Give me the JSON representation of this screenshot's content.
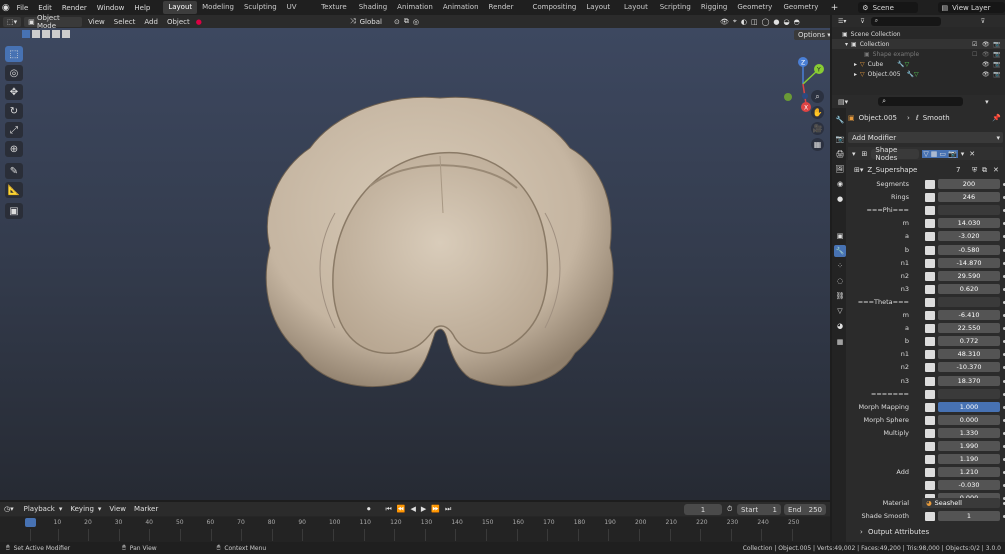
{
  "menus": [
    "File",
    "Edit",
    "Render",
    "Window",
    "Help"
  ],
  "workspaces": [
    "Layout",
    "Modeling",
    "Sculpting",
    "UV Editing",
    "Texture Paint",
    "Shading",
    "Animation",
    "Animation 2",
    "Render Lighting",
    "Compositing",
    "Layout Asset",
    "Layout Shot",
    "Scripting",
    "Rigging",
    "Geometry Nodes",
    "Geometry Nodes 2"
  ],
  "scene": "Scene",
  "view_layer": "View Layer",
  "viewport_header": {
    "mode": "Object Mode",
    "menus": [
      "View",
      "Select",
      "Add",
      "Object"
    ],
    "transform": "Global",
    "options": "Options"
  },
  "outliner": {
    "root": "Scene Collection",
    "collection": "Collection",
    "items": [
      "Shape example",
      "Cube",
      "Object.005"
    ]
  },
  "props": {
    "object": "Object.005",
    "modifier": "Smooth",
    "add_modifier": "Add Modifier",
    "node_group": "Shape Nodes",
    "group_name": "Z_Supershape",
    "group_users": "7",
    "rows": [
      {
        "label": "Segments",
        "value": "200"
      },
      {
        "label": "Rings",
        "value": "246"
      },
      {
        "label": "===Phi===",
        "value": ""
      },
      {
        "label": "m",
        "value": "14.030"
      },
      {
        "label": "a",
        "value": "-3.020"
      },
      {
        "label": "b",
        "value": "-0.580"
      },
      {
        "label": "n1",
        "value": "-14.870"
      },
      {
        "label": "n2",
        "value": "29.590"
      },
      {
        "label": "n3",
        "value": "0.620"
      },
      {
        "label": "===Theta===",
        "value": ""
      },
      {
        "label": "m",
        "value": "-6.410"
      },
      {
        "label": "a",
        "value": "22.550"
      },
      {
        "label": "b",
        "value": "0.772"
      },
      {
        "label": "n1",
        "value": "48.310"
      },
      {
        "label": "n2",
        "value": "-10.370"
      },
      {
        "label": "n3",
        "value": "18.370"
      },
      {
        "label": "=======",
        "value": ""
      },
      {
        "label": "Morph Mapping",
        "value": "1.000"
      },
      {
        "label": "Morph Sphere",
        "value": "0.000"
      },
      {
        "label": "Multiply",
        "value": "1.330"
      },
      {
        "label": "",
        "value": "1.990"
      },
      {
        "label": "",
        "value": "1.190"
      },
      {
        "label": "Add",
        "value": "1.210"
      },
      {
        "label": "",
        "value": "-0.030"
      },
      {
        "label": "",
        "value": "0.000"
      }
    ],
    "material_label": "Material",
    "material": "Seashell",
    "shade_smooth_label": "Shade Smooth",
    "shade_smooth": "1",
    "output_attributes": "Output Attributes"
  },
  "timeline": {
    "menus": [
      "Playback",
      "Keying",
      "View",
      "Marker"
    ],
    "current": "1",
    "start_label": "Start",
    "start": "1",
    "end_label": "End",
    "end": "250",
    "ticks": [
      "1",
      "10",
      "20",
      "30",
      "40",
      "50",
      "60",
      "70",
      "80",
      "90",
      "100",
      "110",
      "120",
      "130",
      "140",
      "150",
      "160",
      "170",
      "180",
      "190",
      "200",
      "210",
      "220",
      "230",
      "240",
      "250"
    ]
  },
  "status": {
    "left": "Set Active Modifier",
    "pan": "Pan View",
    "context": "Context Menu",
    "right": "Collection | Object.005 | Verts:49,002 | Faces:49,200 | Tris:98,000 | Objects:0/2 | 3.0.0"
  },
  "colors": {
    "accent": "#4772b3",
    "shape": "#c8b9a6"
  }
}
